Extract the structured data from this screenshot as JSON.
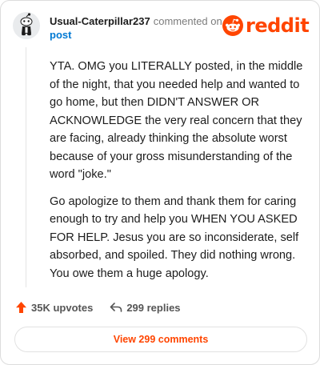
{
  "header": {
    "username": "Usual-Caterpillar237",
    "action_text": "commented on",
    "post_link": "post",
    "logo_text": "reddit"
  },
  "comment": {
    "paragraphs": [
      "YTA. OMG you LITERALLY posted, in the middle of the night, that you needed help and wanted to go home, but then DIDN'T ANSWER OR ACKNOWLEDGE the very real concern that they are facing, already thinking the absolute worst because of your gross misunderstanding of the word \"joke.\"",
      "Go apologize to them and thank them for caring enough to try and help you WHEN YOU ASKED FOR HELP. Jesus you are so inconsiderate, self absorbed, and spoiled. They did nothing wrong. You owe them a huge apology."
    ]
  },
  "actions": {
    "upvotes": "35K upvotes",
    "replies": "299 replies",
    "view_comments": "View 299 comments"
  },
  "colors": {
    "brand": "#ff4500",
    "link": "#0079d3",
    "muted": "#7c7c7c"
  },
  "icons": {
    "avatar": "snoo-avatar-icon",
    "logo": "reddit-snoo-icon",
    "upvote": "upvote-arrow-icon",
    "reply": "reply-arrow-icon"
  }
}
